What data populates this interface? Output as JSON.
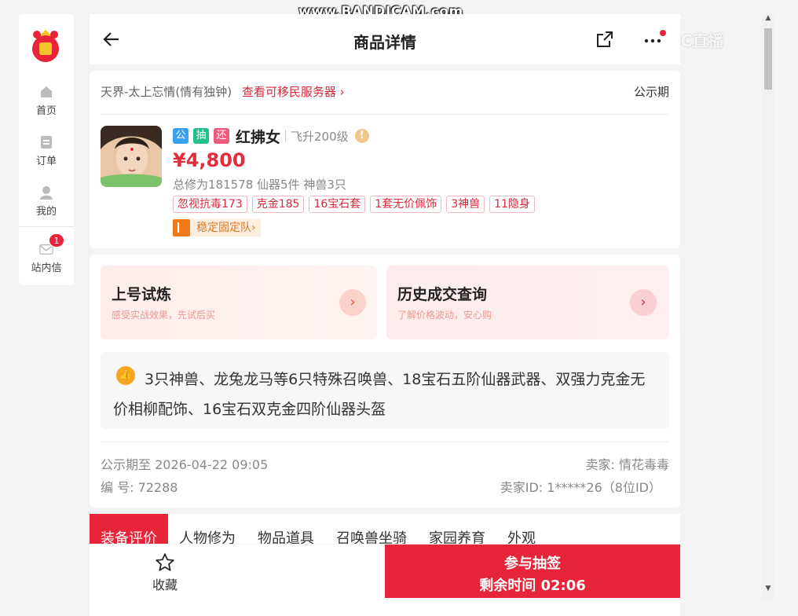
{
  "watermark": "www.BANDICAM.com",
  "cc_watermark": "CC直播",
  "sidebar": {
    "items": [
      {
        "label": "首页",
        "icon": "home-icon"
      },
      {
        "label": "订单",
        "icon": "order-icon"
      },
      {
        "label": "我的",
        "icon": "user-icon"
      },
      {
        "label": "站内信",
        "icon": "mail-icon",
        "badge": "1"
      }
    ]
  },
  "header": {
    "title": "商品详情"
  },
  "product": {
    "server": "天界-太上忘情(情有独钟)",
    "server_link": "查看可移民服务器 ›",
    "status": "公示期",
    "tags": [
      {
        "label": "公",
        "color": "#3aa0f0"
      },
      {
        "label": "抽",
        "color": "#24c08a"
      },
      {
        "label": "还",
        "color": "#ef5a7a"
      }
    ],
    "name": "红拂女",
    "level": "飞升200级",
    "warn": "!",
    "price": "¥4,800",
    "stats": "总修为181578  仙器5件  神兽3只",
    "features": [
      "忽视抗毒173",
      "克金185",
      "16宝石套",
      "1套无价佩饰",
      "3神兽",
      "11隐身"
    ],
    "team_label": "稳定固定队›"
  },
  "promos": [
    {
      "title": "上号试炼",
      "sub": "感受实战效果，先试后买",
      "arrow": "›"
    },
    {
      "title": "历史成交查询",
      "sub": "了解价格波动，安心购",
      "arrow": "›"
    }
  ],
  "highlight": {
    "icon_glyph": "👍",
    "text": "3只神兽、龙兔龙马等6只特殊召唤兽、18宝石五阶仙器武器、双强力克金无价相柳配饰、16宝石双克金四阶仙器头盔"
  },
  "meta": {
    "public_until": "公示期至 2026-04-22 09:05",
    "number": "编 号: 72288",
    "seller": "卖家: 情花毒毒",
    "seller_id": "卖家ID: 1*****26（8位ID）"
  },
  "tabs": [
    "装备评价",
    "人物修为",
    "物品道具",
    "召唤兽坐骑",
    "家园养育",
    "外观"
  ],
  "bottom": {
    "fav_label": "收藏",
    "cta_line1": "参与抽签",
    "cta_line2": "剩余时间 02:06"
  },
  "colors": {
    "accent": "#e8243a",
    "price": "#e22d3d",
    "link": "#d9283a"
  }
}
